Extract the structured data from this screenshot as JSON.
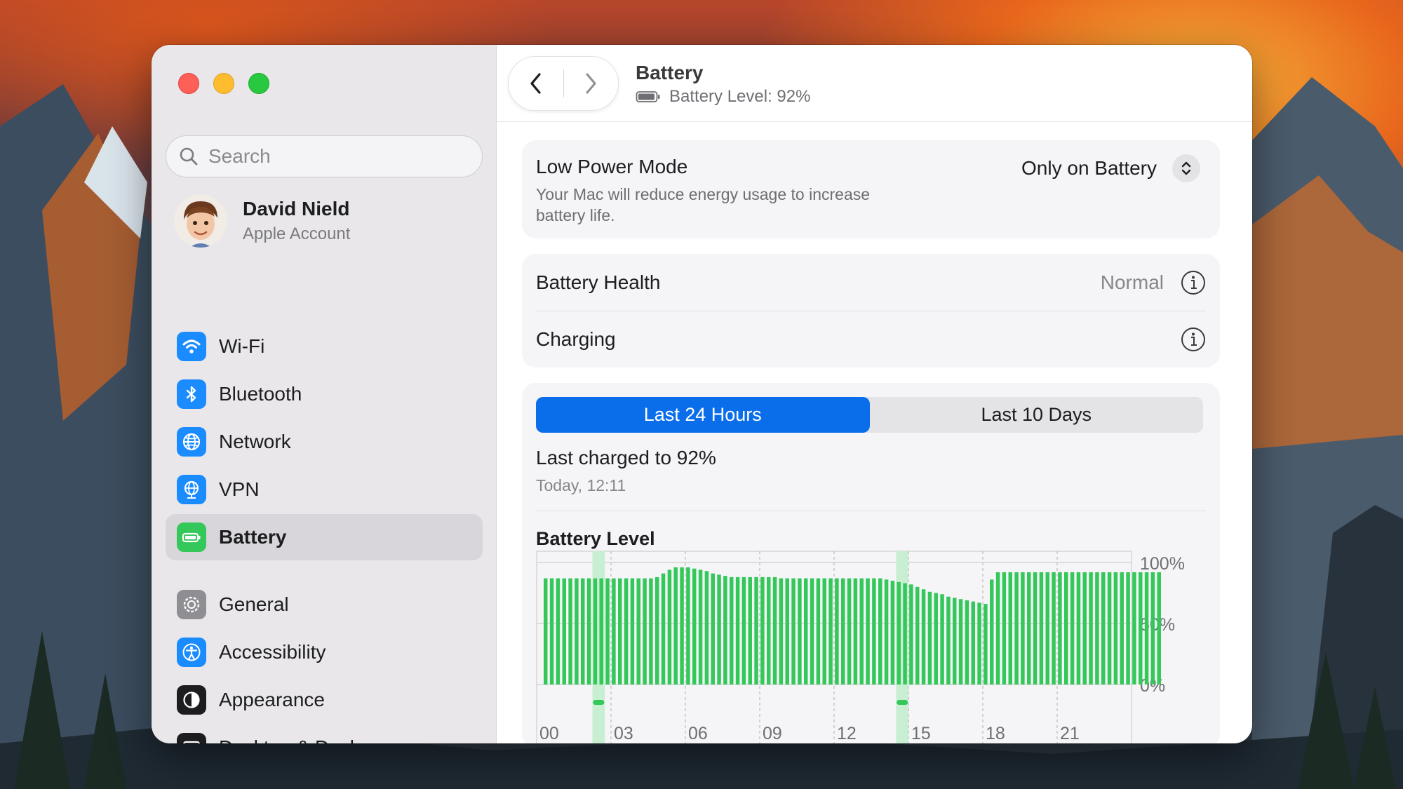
{
  "colors": {
    "accent": "#0a6dea",
    "battery_green": "#34c759",
    "charging_highlight": "#c9efd3",
    "battery_icon_green": "#34c759"
  },
  "sidebar": {
    "search_placeholder": "Search",
    "account": {
      "name": "David Nield",
      "subtitle": "Apple Account"
    },
    "items": [
      {
        "label": "Wi-Fi",
        "icon": "wifi-icon",
        "color": "#1a8cff"
      },
      {
        "label": "Bluetooth",
        "icon": "bluetooth-icon",
        "color": "#1a8cff"
      },
      {
        "label": "Network",
        "icon": "globe-icon",
        "color": "#1a8cff"
      },
      {
        "label": "VPN",
        "icon": "vpn-globe-icon",
        "color": "#1a8cff"
      },
      {
        "label": "Battery",
        "icon": "battery-icon",
        "color": "#34c759",
        "active": true
      },
      {
        "label": "General",
        "icon": "gear-icon",
        "color": "#8e8e93"
      },
      {
        "label": "Accessibility",
        "icon": "accessibility-icon",
        "color": "#1a8cff"
      },
      {
        "label": "Appearance",
        "icon": "appearance-icon",
        "color": "#1d1d1f"
      },
      {
        "label": "Desktop & Dock",
        "icon": "desktop-dock-icon",
        "color": "#1d1d1f"
      }
    ]
  },
  "toolbar": {
    "title": "Battery",
    "subtitle": "Battery Level: 92%"
  },
  "low_power": {
    "title": "Low Power Mode",
    "description": "Your Mac will reduce energy usage to increase battery life.",
    "value": "Only on Battery"
  },
  "health": {
    "battery_health_label": "Battery Health",
    "battery_health_value": "Normal",
    "charging_label": "Charging"
  },
  "usage": {
    "tabs": [
      "Last 24 Hours",
      "Last 10 Days"
    ],
    "selected_tab": 0,
    "last_charged": "Last charged to 92%",
    "last_charged_time": "Today, 12:11",
    "chart_title": "Battery Level"
  },
  "chart_data": {
    "type": "bar",
    "title": "Battery Level",
    "y_tick_labels": [
      "100%",
      "50%",
      "0%"
    ],
    "ylim": [
      0,
      100
    ],
    "x_tick_labels": [
      "00",
      "03",
      "06",
      "09",
      "12",
      "15",
      "18",
      "21"
    ],
    "grid": true,
    "charging_periods_hours": [
      [
        2.25,
        2.75
      ],
      [
        14.5,
        15.0
      ]
    ],
    "series": [
      {
        "values": [
          87,
          87,
          87,
          87,
          87,
          87,
          87,
          87,
          87,
          87,
          87,
          87,
          87,
          87,
          87,
          87,
          87,
          87,
          88,
          91,
          94,
          96,
          96,
          96,
          95,
          94,
          93,
          91,
          90,
          89,
          88,
          88,
          88,
          88,
          88,
          88,
          88,
          88,
          87,
          87,
          87,
          87,
          87,
          87,
          87,
          87,
          87,
          87,
          87,
          87,
          87,
          87,
          87,
          87,
          87,
          86,
          85,
          84,
          83,
          82,
          80,
          78,
          76,
          75,
          74,
          72,
          71,
          70,
          69,
          68,
          67,
          66,
          86,
          92,
          92,
          92,
          92,
          92,
          92,
          92,
          92,
          92,
          92,
          92,
          92,
          92,
          92,
          92,
          92,
          92,
          92,
          92,
          92,
          92,
          92,
          92,
          92,
          92,
          92,
          92
        ]
      }
    ]
  }
}
